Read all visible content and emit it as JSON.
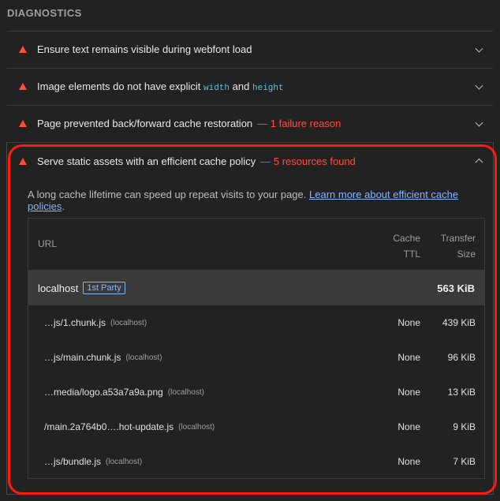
{
  "section": {
    "title": "DIAGNOSTICS"
  },
  "audits": [
    {
      "title": "Ensure text remains visible during webfont load",
      "display_value": ""
    },
    {
      "title_prefix": "Image elements do not have explicit",
      "code1": "width",
      "mid": "and",
      "code2": "height",
      "display_value": ""
    },
    {
      "title": "Page prevented back/forward cache restoration",
      "display_value": "— 1 failure reason"
    },
    {
      "title": "Serve static assets with an efficient cache policy",
      "display_value": "— 5 resources found"
    }
  ],
  "expanded": {
    "description": "A long cache lifetime can speed up repeat visits to your page.",
    "link": "Learn more about efficient cache policies",
    "suffix": ".",
    "table": {
      "headers": {
        "url": "URL",
        "ttl_1": "Cache",
        "ttl_2": "TTL",
        "size_1": "Transfer",
        "size_2": "Size"
      },
      "group": {
        "name": "localhost",
        "badge": "1st Party",
        "size": "563 KiB"
      },
      "rows": [
        {
          "file": "…js/1.chunk.js",
          "host": "(localhost)",
          "ttl": "None",
          "size": "439 KiB"
        },
        {
          "file": "…js/main.chunk.js",
          "host": "(localhost)",
          "ttl": "None",
          "size": "96 KiB"
        },
        {
          "file": "…media/logo.a53a7a9a.png",
          "host": "(localhost)",
          "ttl": "None",
          "size": "13 KiB"
        },
        {
          "file": "/main.2a764b0….hot-update.js",
          "host": "(localhost)",
          "ttl": "None",
          "size": "9 KiB"
        },
        {
          "file": "…js/bundle.js",
          "host": "(localhost)",
          "ttl": "None",
          "size": "7 KiB"
        }
      ]
    }
  },
  "colors": {
    "fail": "#ff4e42",
    "link": "#8ab4f8",
    "highlight": "#ff1a10"
  }
}
